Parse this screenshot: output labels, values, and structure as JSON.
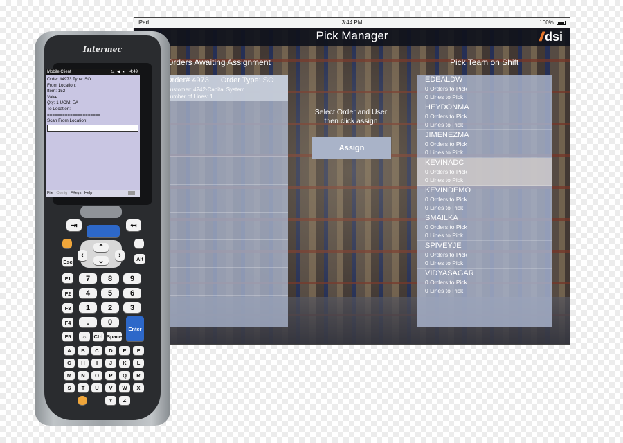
{
  "status_bar": {
    "carrier": "iPad",
    "time": "3:44 PM",
    "battery": "100%"
  },
  "app": {
    "title": "Pick Manager",
    "logo_text": "dsi",
    "logo_mark": "//"
  },
  "orders_panel": {
    "header": "Orders Awaiting Assignment",
    "order": {
      "number": "Order# 4973",
      "type": "Order Type: SO",
      "customer": "Customer: 4242-Capital System",
      "lines": "Number of Lines: 1"
    }
  },
  "instructions": {
    "line1": "Select Order and User",
    "line2": "then click assign"
  },
  "assign_button": "Assign",
  "team_panel": {
    "header": "Pick Team on Shift",
    "members": [
      {
        "name": "EDEALDW",
        "orders": "0 Orders to Pick",
        "lines": "0 Lines to Pick"
      },
      {
        "name": "HEYDONMA",
        "orders": "0 Orders to Pick",
        "lines": "0 Lines to Pick"
      },
      {
        "name": "JIMENEZMA",
        "orders": "0 Orders to Pick",
        "lines": "0 Lines to Pick"
      },
      {
        "name": "KEVINADC",
        "orders": "0 Orders to Pick",
        "lines": "0 Lines to Pick"
      },
      {
        "name": "KEVINDEMO",
        "orders": "0 Orders to Pick",
        "lines": "0 Lines to Pick"
      },
      {
        "name": "SMAILKA",
        "orders": "0 Orders to Pick",
        "lines": "0 Lines to Pick"
      },
      {
        "name": "SPIVEYJE",
        "orders": "0 Orders to Pick",
        "lines": "0 Lines to Pick"
      },
      {
        "name": "VIDYASAGAR",
        "orders": "0 Orders to Pick",
        "lines": "0 Lines to Pick"
      }
    ],
    "selected_member": "KEVINADC"
  },
  "device": {
    "brand": "Intermec",
    "screen": {
      "title": "Mobile Client",
      "time": "4:49",
      "lines": [
        "Order #4973     Type: SO",
        "From Location:",
        "Item: 152",
        "Valve",
        "Qty: 1     UOM: EA",
        "To Location:",
        "=====================",
        "Scan From Location:"
      ],
      "menu": [
        "File",
        "Config",
        "FKeys",
        "Help"
      ]
    },
    "keys": {
      "numbers": [
        "7",
        "8",
        "9",
        "4",
        "5",
        "6",
        "1",
        "2",
        "3",
        ".",
        "0"
      ],
      "fkeys": [
        "F1",
        "F2",
        "F3",
        "F4",
        "F5"
      ],
      "enter": "Enter",
      "space": "Space",
      "ctrl": "Ctrl",
      "letters": [
        "A",
        "B",
        "C",
        "D",
        "E",
        "F",
        "G",
        "H",
        "I",
        "J",
        "K",
        "L",
        "M",
        "N",
        "O",
        "P",
        "Q",
        "R",
        "S",
        "T",
        "U",
        "V",
        "W",
        "X",
        "Y",
        "Z"
      ]
    }
  }
}
